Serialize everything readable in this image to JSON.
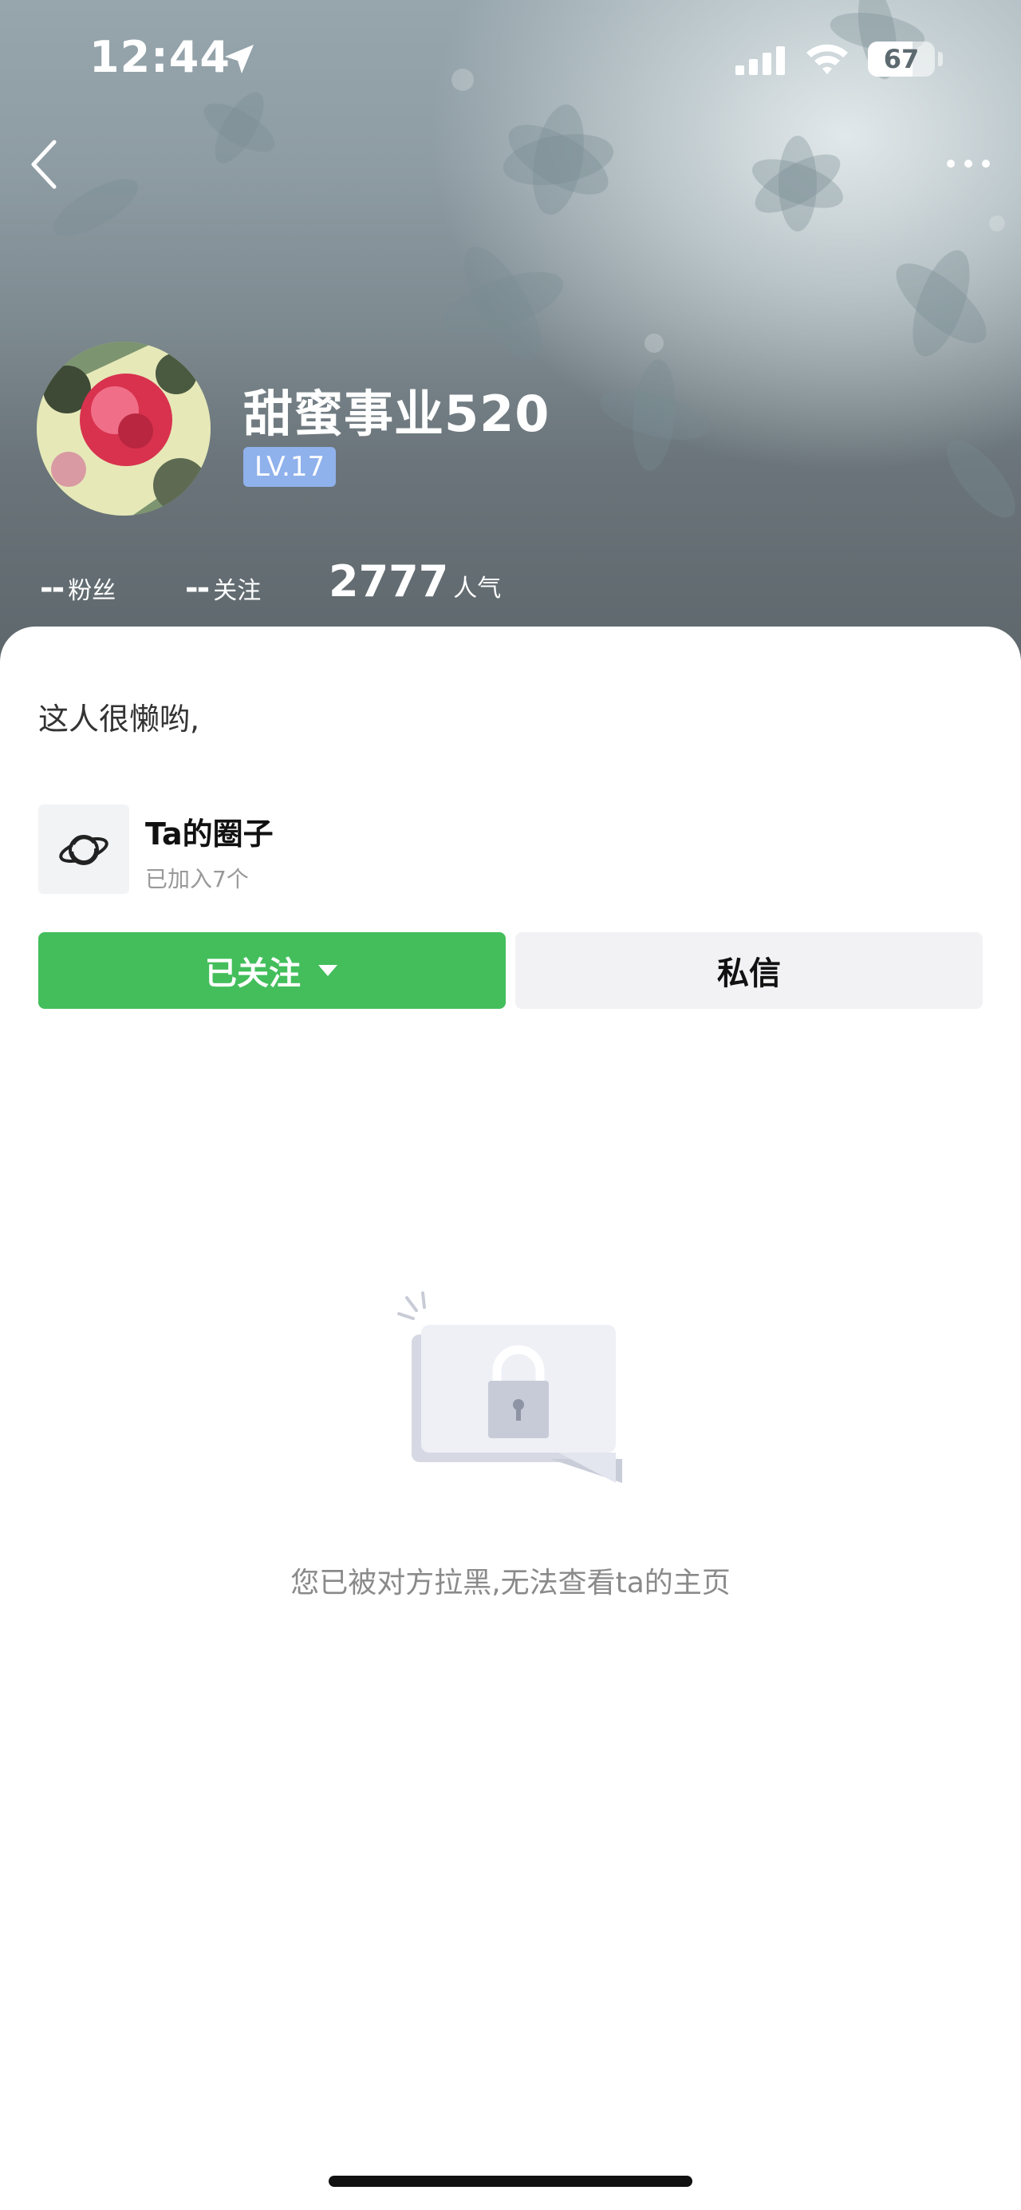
{
  "status_bar": {
    "time": "12:44",
    "battery_percent": 67,
    "battery_text": "67"
  },
  "profile": {
    "username": "甜蜜事业520",
    "level": "LV.17",
    "stats": {
      "fans_value": "--",
      "fans_label": "粉丝",
      "following_value": "--",
      "following_label": "关注",
      "popularity_value": "2777",
      "popularity_label": "人气"
    },
    "bio": "这人很懒哟,"
  },
  "circles": {
    "title": "Ta的圈子",
    "joined_text": "已加入7个"
  },
  "actions": {
    "follow_label": "已关注",
    "message_label": "私信"
  },
  "blocked": {
    "message": "您已被对方拉黑,无法查看ta的主页"
  },
  "colors": {
    "follow_button": "#43be5b",
    "message_button": "#f2f2f5",
    "level_badge": "#8fb1ec",
    "muted_text": "#8a8a8a"
  },
  "icons": {
    "back": "chevron-left-icon",
    "more": "ellipsis-icon",
    "location": "location-arrow-icon",
    "signal": "cellular-signal-icon",
    "wifi": "wifi-icon",
    "battery": "battery-icon",
    "circle": "planet-icon",
    "dropdown": "caret-down-icon",
    "lock": "lock-icon"
  }
}
